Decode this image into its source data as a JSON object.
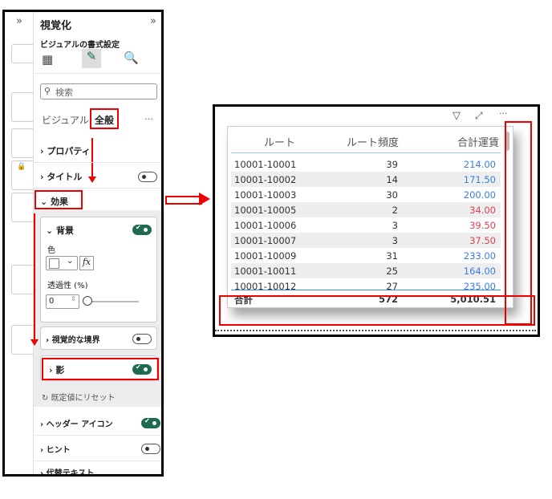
{
  "panel": {
    "title": "視覚化",
    "subtitle": "ビジュアルの書式設定",
    "search_placeholder": "検索",
    "tabs": [
      {
        "label": "ビジュアル"
      },
      {
        "label": "全般"
      }
    ],
    "more": "…",
    "sections": {
      "properties": "プロパティ",
      "title": "タイトル",
      "effects": "効果",
      "background": "背景",
      "color_label": "色",
      "fx": "fx",
      "transparency_label": "透過性 (%)",
      "transparency_value": "0",
      "visual_border": "視覚的な境界",
      "shadow": "影",
      "reset": "既定値にリセット",
      "header_icons": "ヘッダー アイコン",
      "tooltips": "ヒント",
      "alt_text": "代替テキスト"
    },
    "toggles": {
      "title": false,
      "background": true,
      "visual_border": false,
      "shadow": true,
      "header_icons": true,
      "tooltips": false
    },
    "transparency": 0
  },
  "table": {
    "headers": [
      "ルート",
      "ルート頻度",
      "合計運賃"
    ],
    "rows": [
      [
        "10001-10001",
        "39",
        "214.00",
        "#3a7fe0"
      ],
      [
        "10001-10002",
        "14",
        "171.50",
        "#3a7fe0"
      ],
      [
        "10001-10003",
        "30",
        "200.00",
        "#3a7fe0"
      ],
      [
        "10001-10005",
        "2",
        "34.00",
        "#d9434f"
      ],
      [
        "10001-10006",
        "3",
        "39.50",
        "#d9434f"
      ],
      [
        "10001-10007",
        "3",
        "37.50",
        "#d9434f"
      ],
      [
        "10001-10009",
        "31",
        "233.00",
        "#3a7fe0"
      ],
      [
        "10001-10011",
        "25",
        "164.00",
        "#3a7fe0"
      ],
      [
        "10001-10012",
        "27",
        "235.00",
        "#3a7fe0"
      ]
    ],
    "total": [
      "合計",
      "572",
      "5,010.51"
    ],
    "more": "···"
  }
}
